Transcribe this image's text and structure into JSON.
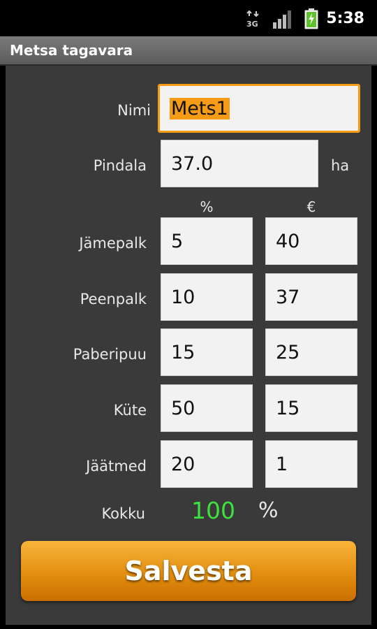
{
  "status_bar": {
    "time": "5:38",
    "network_label": "3G",
    "icons": [
      "data-3g-icon",
      "signal-icon",
      "battery-charging-icon"
    ]
  },
  "app": {
    "title": "Metsa tagavara"
  },
  "form": {
    "name": {
      "label": "Nimi",
      "value": "Mets1"
    },
    "area": {
      "label": "Pindala",
      "value": "37.0",
      "unit": "ha"
    },
    "columns": {
      "percent": "%",
      "price": "€"
    },
    "rows": [
      {
        "label": "Jämepalk",
        "percent": "5",
        "price": "40"
      },
      {
        "label": "Peenpalk",
        "percent": "10",
        "price": "37"
      },
      {
        "label": "Paberipuu",
        "percent": "15",
        "price": "25"
      },
      {
        "label": "Küte",
        "percent": "50",
        "price": "15"
      },
      {
        "label": "Jäätmed",
        "percent": "20",
        "price": "1"
      }
    ],
    "total": {
      "label": "Kokku",
      "value": "100",
      "unit": "%"
    }
  },
  "actions": {
    "save_label": "Salvesta"
  },
  "colors": {
    "accent": "#f59b15",
    "total": "#3ee13e",
    "background": "#3a3a3a"
  }
}
